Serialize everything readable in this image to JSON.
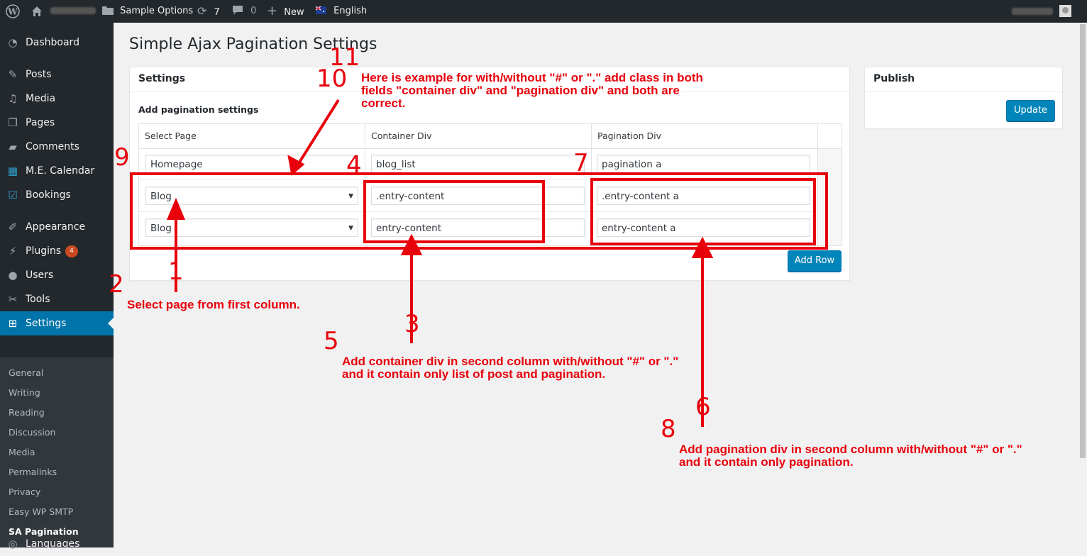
{
  "adminbar": {
    "site_options": "Sample Options",
    "updates_count": "7",
    "comments_count": "0",
    "new_label": "New",
    "language": "English"
  },
  "sidebar": {
    "items": [
      {
        "label": "Dashboard",
        "icon": "dashboard-icon"
      },
      {
        "label": "Posts",
        "icon": "pin-icon"
      },
      {
        "label": "Media",
        "icon": "media-icon"
      },
      {
        "label": "Pages",
        "icon": "pages-icon"
      },
      {
        "label": "Comments",
        "icon": "comment-icon"
      },
      {
        "label": "M.E. Calendar",
        "icon": "calendar-icon"
      },
      {
        "label": "Bookings",
        "icon": "bookings-icon"
      },
      {
        "label": "Appearance",
        "icon": "brush-icon"
      },
      {
        "label": "Plugins",
        "icon": "plugin-icon",
        "badge": "4"
      },
      {
        "label": "Users",
        "icon": "users-icon"
      },
      {
        "label": "Tools",
        "icon": "wrench-icon"
      },
      {
        "label": "Settings",
        "icon": "settings-icon"
      },
      {
        "label": "Languages",
        "icon": "languages-icon"
      }
    ],
    "submenu": [
      "General",
      "Writing",
      "Reading",
      "Discussion",
      "Media",
      "Permalinks",
      "Privacy",
      "Easy WP SMTP",
      "SA Pagination"
    ]
  },
  "page": {
    "title": "Simple Ajax Pagination Settings",
    "settings_box_title": "Settings",
    "section_label": "Add pagination settings",
    "table": {
      "headers": [
        "Select Page",
        "Container Div",
        "Pagination Div"
      ],
      "rows": [
        {
          "page": "Homepage",
          "container": "blog_list",
          "pagination": "pagination a"
        },
        {
          "page": "Blog",
          "container": ".entry-content",
          "pagination": ".entry-content a"
        },
        {
          "page": "Blog",
          "container": "entry-content",
          "pagination": "entry-content a"
        }
      ]
    },
    "add_row_label": "Add Row",
    "publish_title": "Publish",
    "update_label": "Update"
  },
  "annotations": {
    "numbers": [
      "1",
      "2",
      "3",
      "4",
      "5",
      "6",
      "7",
      "8",
      "9",
      "10",
      "11"
    ],
    "notes": {
      "example": "Here is example for with/without \"#\" or \".\" add class in both fields \"container div\" and \"pagination div\" and both are correct.",
      "select_page": "Select page from first column.",
      "container": "Add container div in second column with/without \"#\" or \".\" and it contain only list of post and pagination.",
      "pagination": "Add pagination div in second column with/without \"#\" or \".\" and it contain only pagination."
    },
    "color": "#e8000b"
  }
}
